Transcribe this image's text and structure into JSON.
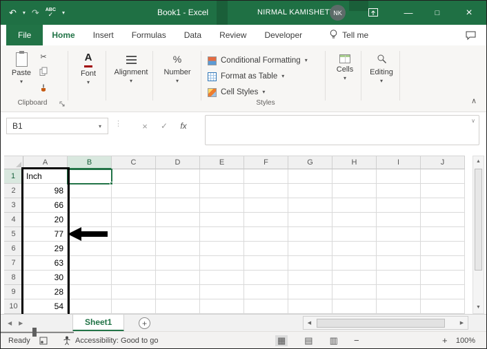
{
  "colors": {
    "brand_green": "#217346",
    "titlebar_green": "#1f7044",
    "selection_green": "#217346",
    "range_border": "#000000"
  },
  "title_bar": {
    "title": "Book1 - Excel",
    "user_name": "NIRMAL KAMISHETTY",
    "user_initials": "NK"
  },
  "tabs": {
    "file": "File",
    "home": "Home",
    "insert": "Insert",
    "formulas": "Formulas",
    "data": "Data",
    "review": "Review",
    "developer": "Developer",
    "tell_me": "Tell me"
  },
  "ribbon": {
    "paste": "Paste",
    "clipboard_label": "Clipboard",
    "font": "Font",
    "alignment": "Alignment",
    "number": "Number",
    "conditional_formatting": "Conditional Formatting",
    "format_as_table": "Format as Table",
    "cell_styles": "Cell Styles",
    "styles_label": "Styles",
    "cells": "Cells",
    "editing": "Editing"
  },
  "formula_bar": {
    "name_box": "B1",
    "fx": "fx",
    "formula": ""
  },
  "grid": {
    "columns": [
      "A",
      "B",
      "C",
      "D",
      "E",
      "F",
      "G",
      "H",
      "I",
      "J"
    ],
    "rows": [
      "1",
      "2",
      "3",
      "4",
      "5",
      "6",
      "7",
      "8",
      "9",
      "10"
    ],
    "col_a": [
      "Inch",
      "98",
      "66",
      "20",
      "77",
      "29",
      "63",
      "30",
      "28",
      "54"
    ],
    "selected_cell": "B1",
    "selected_column": "B",
    "selected_row": "1"
  },
  "sheet_bar": {
    "active_sheet": "Sheet1",
    "new_sheet": "+"
  },
  "status_bar": {
    "mode": "Ready",
    "accessibility": "Accessibility: Good to go",
    "zoom_out": "−",
    "zoom_in": "+",
    "zoom": "100%"
  },
  "icons": {
    "undo": "↶",
    "redo": "↷",
    "abc": "ABC",
    "check": "✓",
    "dropdown": "▾",
    "cancel": "×",
    "minimize": "—",
    "maximize": "□",
    "close": "×",
    "cut": "✂",
    "collapse_ribbon": "∧",
    "up": "▲",
    "down": "▼",
    "left": "◀",
    "right": "▶",
    "view_normal": "▦",
    "view_layout": "▤",
    "view_break": "▥",
    "dots": "⋮",
    "expand_formula": "∨",
    "percent": "%",
    "font_a": "A"
  }
}
